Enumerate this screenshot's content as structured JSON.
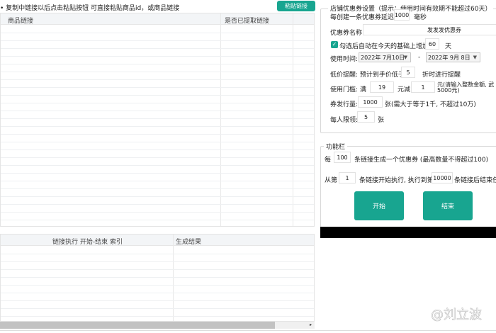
{
  "top": {
    "hint": "• 复制中链接以后点击粘贴按钮 可直接粘贴商品id，或商品链接",
    "paste_button": "粘贴链接"
  },
  "link_table": {
    "columns": [
      "商品链接",
      "是否已提取链接"
    ]
  },
  "result_table": {
    "columns": [
      "链接执行  开始-结束  索引",
      "生成结果"
    ]
  },
  "coupon_settings": {
    "title": "店铺优惠券设置（提示：使用时间有效期不能超过60天）",
    "delay_label": "每创建一条优惠券延迟:",
    "delay_value": "1000",
    "delay_unit": "毫秒",
    "name_label": "优惠券名称:",
    "name_value": "发发发优惠券",
    "auto_add_label": "勾选后自动在今天的基础上增加",
    "auto_add_checked": true,
    "auto_add_value": "60",
    "auto_add_unit": "天",
    "time_label": "使用时间:",
    "start_date": "2022年 7月10日",
    "dash": "-",
    "end_date": "2022年 9月 8日",
    "low_price_label": "低价提醒: 预计到手价低于",
    "low_price_value": "5",
    "low_price_unit": "折时进行提醒",
    "threshold_label": "使用门槛: 满",
    "threshold_value": "19",
    "minus_label": "元减",
    "minus_value": "1",
    "minus_note_1": "元(请输入整数金额, 武",
    "minus_note_2": "5000元)",
    "quantity_label": "券发行量:",
    "quantity_value": "1000",
    "quantity_note": "张(需大于等于1千, 不超过10万)",
    "limit_label": "每人限领:",
    "limit_value": "5",
    "limit_unit": "张"
  },
  "function_bar": {
    "title": "功能栏",
    "per_label": "每",
    "per_value": "100",
    "per_note": "条链接生成一个优惠券 (最高数量不得超过100)",
    "from_label": "从第",
    "from_value": "1",
    "from_note": "条链接开始执行, 执行到第",
    "to_value": "10000",
    "to_note": "条链接后结束任务",
    "start_button": "开始",
    "end_button": "结束"
  },
  "watermark": "@刘立波",
  "colors": {
    "accent": "#18a590"
  }
}
